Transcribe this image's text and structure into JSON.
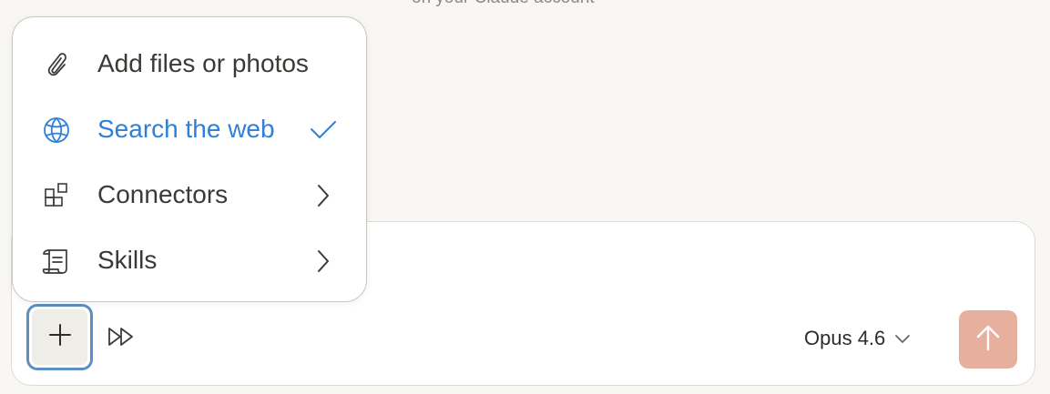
{
  "background_note": "on your Claude account",
  "menu": {
    "items": [
      {
        "label": "Add files or photos",
        "icon": "paperclip-icon"
      },
      {
        "label": "Search the web",
        "icon": "globe-icon",
        "checked": true,
        "accent": "#2F80D6"
      },
      {
        "label": "Connectors",
        "icon": "connectors-icon",
        "trailing": "chevron-right-icon"
      },
      {
        "label": "Skills",
        "icon": "scroll-icon",
        "trailing": "chevron-right-icon"
      }
    ]
  },
  "composer": {
    "add_icon": "plus-icon",
    "mode_icon": "fast-forward-icon",
    "model": "Opus 4.6",
    "model_dropdown_icon": "chevron-down-icon",
    "send_icon": "arrow-up-icon",
    "send_color": "#E7B09E",
    "focus_ring_color": "#5C8FC2"
  }
}
